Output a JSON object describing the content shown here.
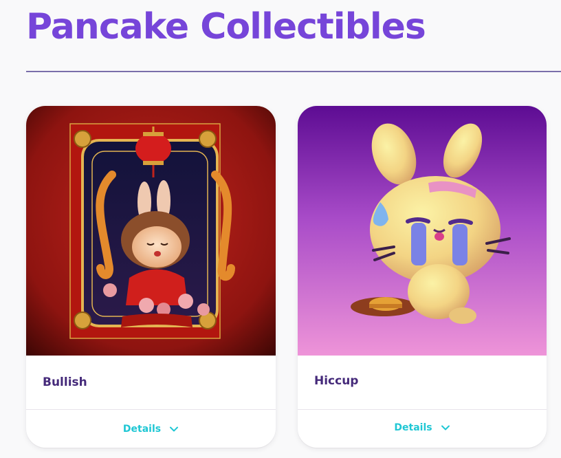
{
  "page": {
    "title": "Pancake Collectibles"
  },
  "colors": {
    "title": "#7645d9",
    "name": "#452a7a",
    "accent": "#1fc7d4"
  },
  "cards": [
    {
      "name": "Bullish",
      "details_label": "Details",
      "icon": "chevron-down-icon"
    },
    {
      "name": "Hiccup",
      "details_label": "Details",
      "icon": "chevron-down-icon"
    }
  ]
}
